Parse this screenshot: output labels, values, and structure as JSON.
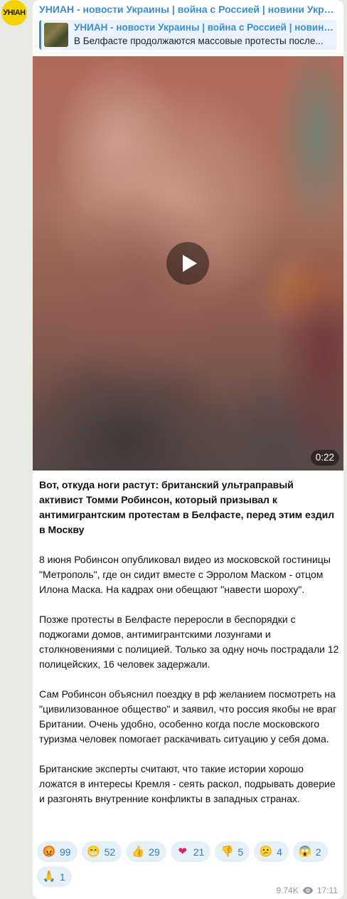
{
  "channel": {
    "avatar_text": "УНІАН",
    "name": "УНИАН - новости Украины | война с Россией | новини Україні..."
  },
  "reply": {
    "title": "УНИАН - новости Украины | война с Россией | новини...",
    "text": "В Белфасте продолжаются массовые протесты после..."
  },
  "video": {
    "duration": "0:22"
  },
  "message": {
    "headline": "Вот, откуда ноги растут: британский ультраправый активист Томми Робинсон, который призывал к антимигрантским протестам в Белфасте, перед этим ездил в Москву",
    "paragraphs": [
      "8 июня Робинсон опубликовал видео из московской гостиницы \"Метрополь\", где он сидит вместе с Эрролом Маском - отцом Илона Маска. На кадрах они обещают \"навести шороху\".",
      "Позже протесты в Белфасте переросли в беспорядки с поджогами домов, антимигрантскими лозунгами и столкновениями с полицией. Только за одну ночь пострадали 12 полицейских, 16 человек задержали.",
      "Сам Робинсон объяснил поездку в рф желанием посмотреть на \"цивилизованное общество\" и заявил, что россия якобы не враг Британии. Очень удобно, особенно когда после московского туризма человек помогает раскачивать ситуацию у себя дома.",
      "Британские эксперты считают, что такие истории хорошо ложатся в интересы Кремля - сеять раскол, подрывать доверие и разгонять внутренние конфликты в западных странах."
    ]
  },
  "reactions": [
    {
      "icon": "angry-face-icon",
      "emoji": "😡",
      "count": "99"
    },
    {
      "icon": "grin-face-icon",
      "emoji": "😁",
      "count": "52"
    },
    {
      "icon": "thumbs-up-icon",
      "emoji": "👍",
      "count": "29"
    },
    {
      "icon": "heart-icon",
      "emoji": "❤",
      "count": "21"
    },
    {
      "icon": "thumbs-down-icon",
      "emoji": "👎",
      "count": "5"
    },
    {
      "icon": "confused-face-icon",
      "emoji": "😕",
      "count": "4"
    },
    {
      "icon": "scream-face-icon",
      "emoji": "😱",
      "count": "2"
    },
    {
      "icon": "pray-icon",
      "emoji": "🙏",
      "count": "1"
    }
  ],
  "footer": {
    "views": "9.74K",
    "time": "17:11"
  },
  "colors": {
    "accent": "#3a8fd0",
    "reaction_bg": "#e6f0f9",
    "avatar": "#f5d300"
  }
}
